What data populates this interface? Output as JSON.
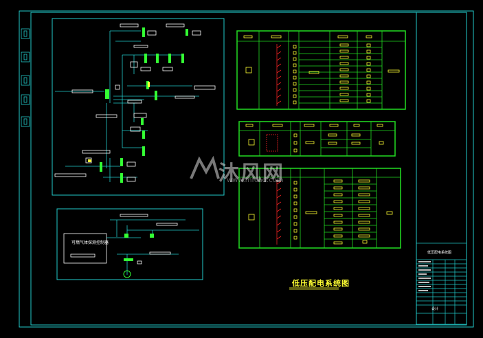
{
  "drawing": {
    "title": "低压配电系统图",
    "device_label": "可燃气体探测控制器",
    "title_block_name": "低压配电系统图",
    "title_block_drawer": "设计"
  },
  "watermark": {
    "brand": "沐风网",
    "url": "www.mfcad.com"
  },
  "colors": {
    "background": "#000000",
    "frame": "#22cccc",
    "table": "#22dd22",
    "breaker": "#ee2222",
    "highlight": "#ffff33",
    "busbar": "#33ff33",
    "text_box": "#ffffff"
  }
}
